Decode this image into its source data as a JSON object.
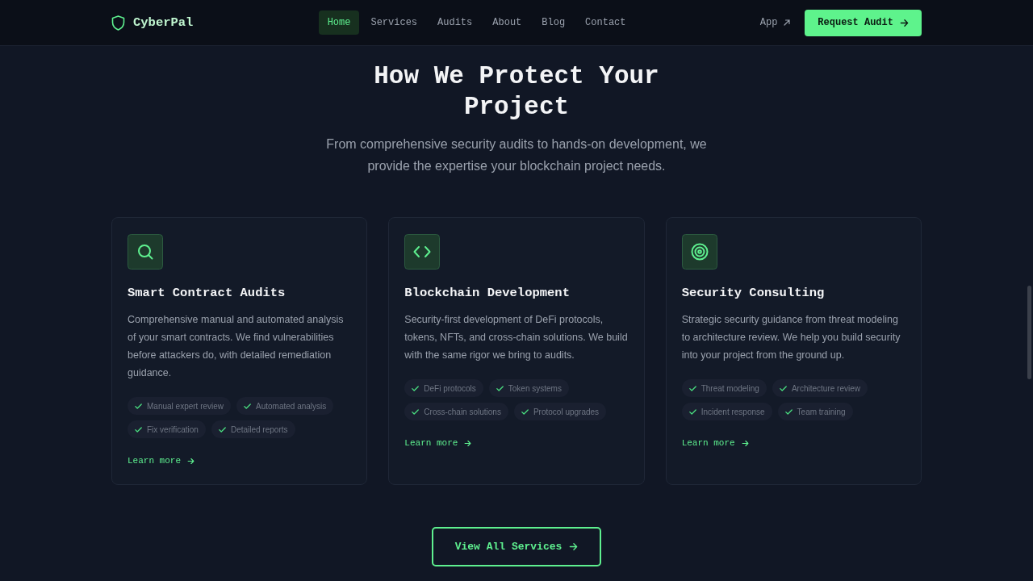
{
  "nav": {
    "logo": "CyberPal",
    "links": [
      {
        "label": "Home",
        "selected": true
      },
      {
        "label": "Services",
        "selected": false
      },
      {
        "label": "Audits",
        "selected": false
      },
      {
        "label": "About",
        "selected": false
      },
      {
        "label": "Blog",
        "selected": false
      },
      {
        "label": "Contact",
        "selected": false
      }
    ],
    "app_link": "App",
    "cta": "Request Audit"
  },
  "section": {
    "title": "How We Protect Your Project",
    "subtitle": "From comprehensive security audits to hands-on development, we provide the expertise your blockchain project needs."
  },
  "services": [
    {
      "title": "Smart Contract Audits",
      "description": "Comprehensive manual and automated analysis of your smart contracts. We find vulnerabilities before attackers do, with detailed remediation guidance.",
      "features": [
        "Manual expert review",
        "Automated analysis",
        "Fix verification",
        "Detailed reports"
      ],
      "link": "Learn more"
    },
    {
      "title": "Blockchain Development",
      "description": "Security-first development of DeFi protocols, tokens, NFTs, and cross-chain solutions. We build with the same rigor we bring to audits.",
      "features": [
        "DeFi protocols",
        "Token systems",
        "Cross-chain solutions",
        "Protocol upgrades"
      ],
      "link": "Learn more"
    },
    {
      "title": "Security Consulting",
      "description": "Strategic security guidance from threat modeling to architecture review. We help you build security into your project from the ground up.",
      "features": [
        "Threat modeling",
        "Architecture review",
        "Incident response",
        "Team training"
      ],
      "link": "Learn more"
    }
  ],
  "all_services_button": "View All Services"
}
